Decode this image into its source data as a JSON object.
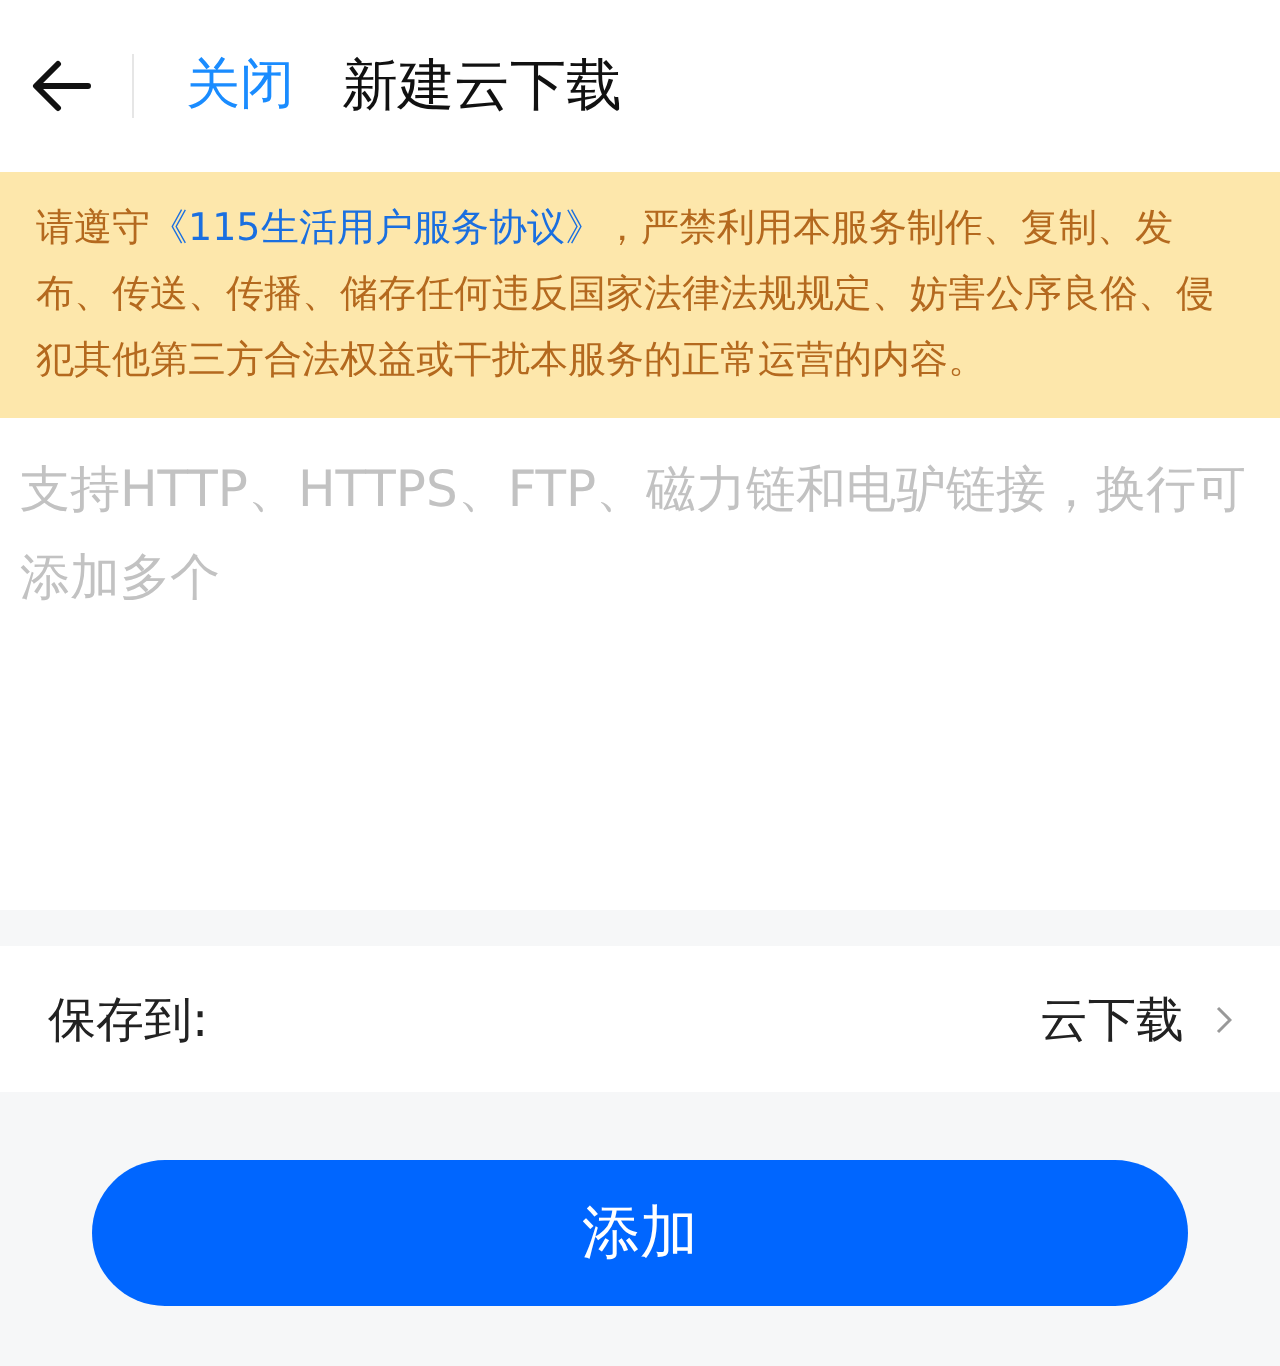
{
  "header": {
    "close": "关闭",
    "title": "新建云下载"
  },
  "notice": {
    "before": "请遵守",
    "link": "《115生活用户服务协议》",
    "after": "，严禁利用本服务制作、复制、发布、传送、传播、储存任何违反国家法律法规规定、妨害公序良俗、侵犯其他第三方合法权益或干扰本服务的正常运营的内容。"
  },
  "link_input": {
    "placeholder": "支持HTTP、HTTPS、FTP、磁力链和电驴链接，换行可添加多个"
  },
  "save_to": {
    "label": "保存到:",
    "value": "云下载"
  },
  "add_button": "添加"
}
